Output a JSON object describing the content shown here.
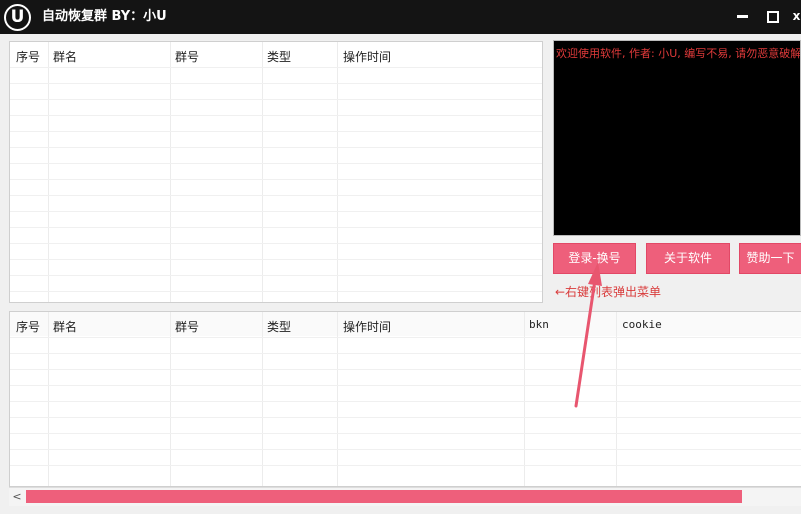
{
  "window": {
    "logo_letter": "U",
    "title": "自动恢复群 BY：小U",
    "min_icon": "minimize-icon",
    "max_icon": "maximize-icon",
    "close_glyph": "x"
  },
  "top_table": {
    "columns": [
      "序号",
      "群名",
      "群号",
      "类型",
      "操作时间"
    ]
  },
  "bottom_table": {
    "columns": [
      "序号",
      "群名",
      "群号",
      "类型",
      "操作时间",
      "bkn",
      "cookie"
    ]
  },
  "console": {
    "text": "欢迎使用软件, 作者: 小U, 编写不易, 请勿恶意破解"
  },
  "buttons": {
    "login": "登录-换号",
    "about": "关于软件",
    "donate": "赞助一下"
  },
  "hint": "←右键列表弹出菜单",
  "scroll": {
    "left_glyph": "<"
  },
  "colors": {
    "accent": "#ee5f7b",
    "titlebar": "#141414",
    "console_bg": "#000000",
    "console_text": "#e03a3a"
  }
}
